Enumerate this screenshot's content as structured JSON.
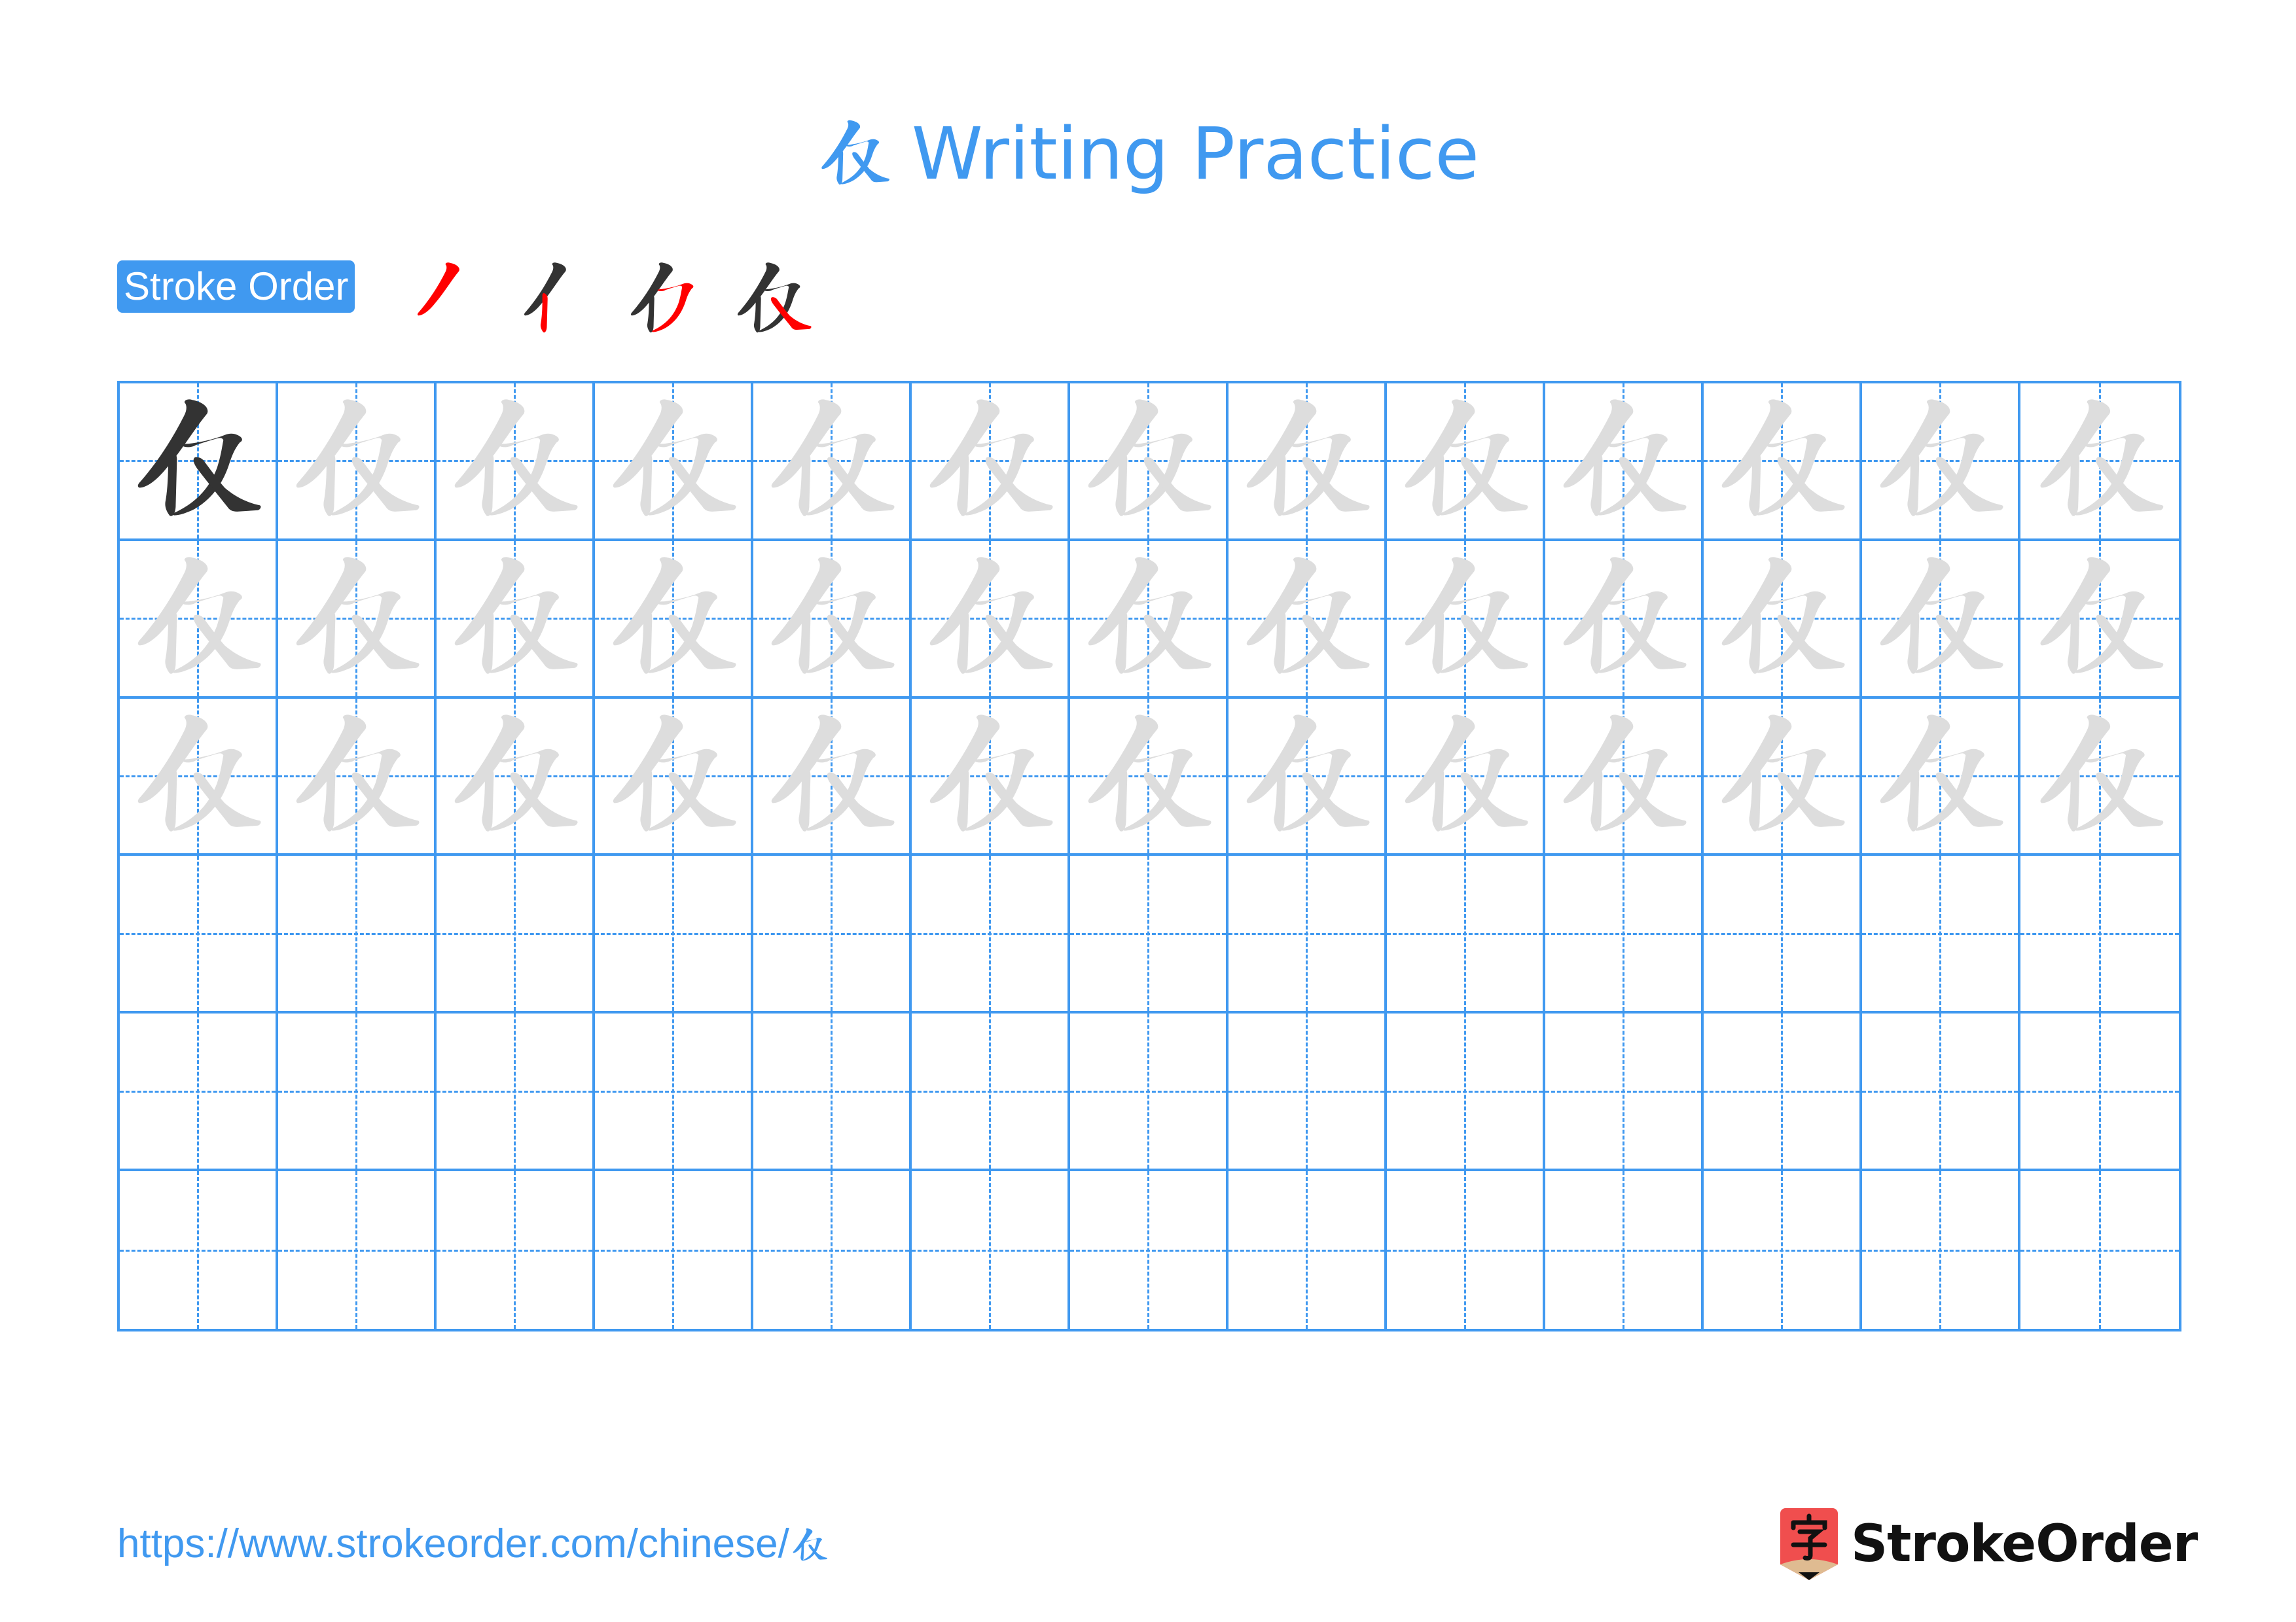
{
  "page": {
    "title_character": "仅",
    "title_suffix": "Writing Practice"
  },
  "stroke_order": {
    "label": "Stroke Order",
    "step_count": 4,
    "colors": {
      "previous": "#333333",
      "current": "#ff0000"
    }
  },
  "practice_grid": {
    "character": "仅",
    "rows": 6,
    "columns": 13,
    "model_cells": 1,
    "trace_rows": 3,
    "blank_rows": 3,
    "colors": {
      "grid": "#4099f0",
      "model": "#333333",
      "trace": "#dddddd"
    }
  },
  "footer": {
    "url_prefix": "https://www.strokeorder.com/chinese/",
    "url_character": "仅",
    "brand": "StrokeOrder",
    "logo_glyph": "字",
    "colors": {
      "link": "#4099f0",
      "logo_red": "#f04e4e",
      "logo_tan": "#dfbb91"
    }
  }
}
